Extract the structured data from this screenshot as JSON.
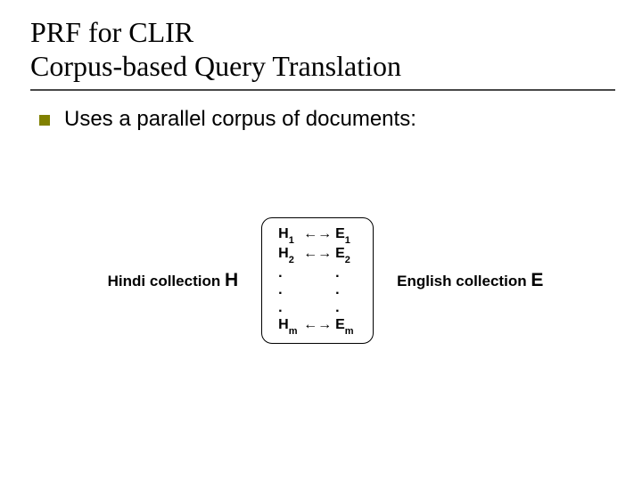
{
  "title": {
    "line1": "PRF for CLIR",
    "line2": "Corpus-based Query Translation"
  },
  "bullet": {
    "text": "Uses a parallel corpus of documents:"
  },
  "diagram": {
    "left_label_prefix": "Hindi collection ",
    "left_label_symbol": "H",
    "right_label_prefix": "English collection ",
    "right_label_symbol": "E",
    "rows": [
      {
        "l_base": "H",
        "l_sub": "1",
        "arrow": "←→",
        "r_base": "E",
        "r_sub": "1"
      },
      {
        "l_base": "H",
        "l_sub": "2",
        "arrow": "←→",
        "r_base": "E",
        "r_sub": "2"
      },
      {
        "l_base": ".",
        "l_sub": "",
        "arrow": "",
        "r_base": ".",
        "r_sub": ""
      },
      {
        "l_base": ".",
        "l_sub": "",
        "arrow": "",
        "r_base": ".",
        "r_sub": ""
      },
      {
        "l_base": ".",
        "l_sub": "",
        "arrow": "",
        "r_base": ".",
        "r_sub": ""
      },
      {
        "l_base": "H",
        "l_sub": "m",
        "arrow": "←→",
        "r_base": "E",
        "r_sub": "m"
      }
    ]
  }
}
